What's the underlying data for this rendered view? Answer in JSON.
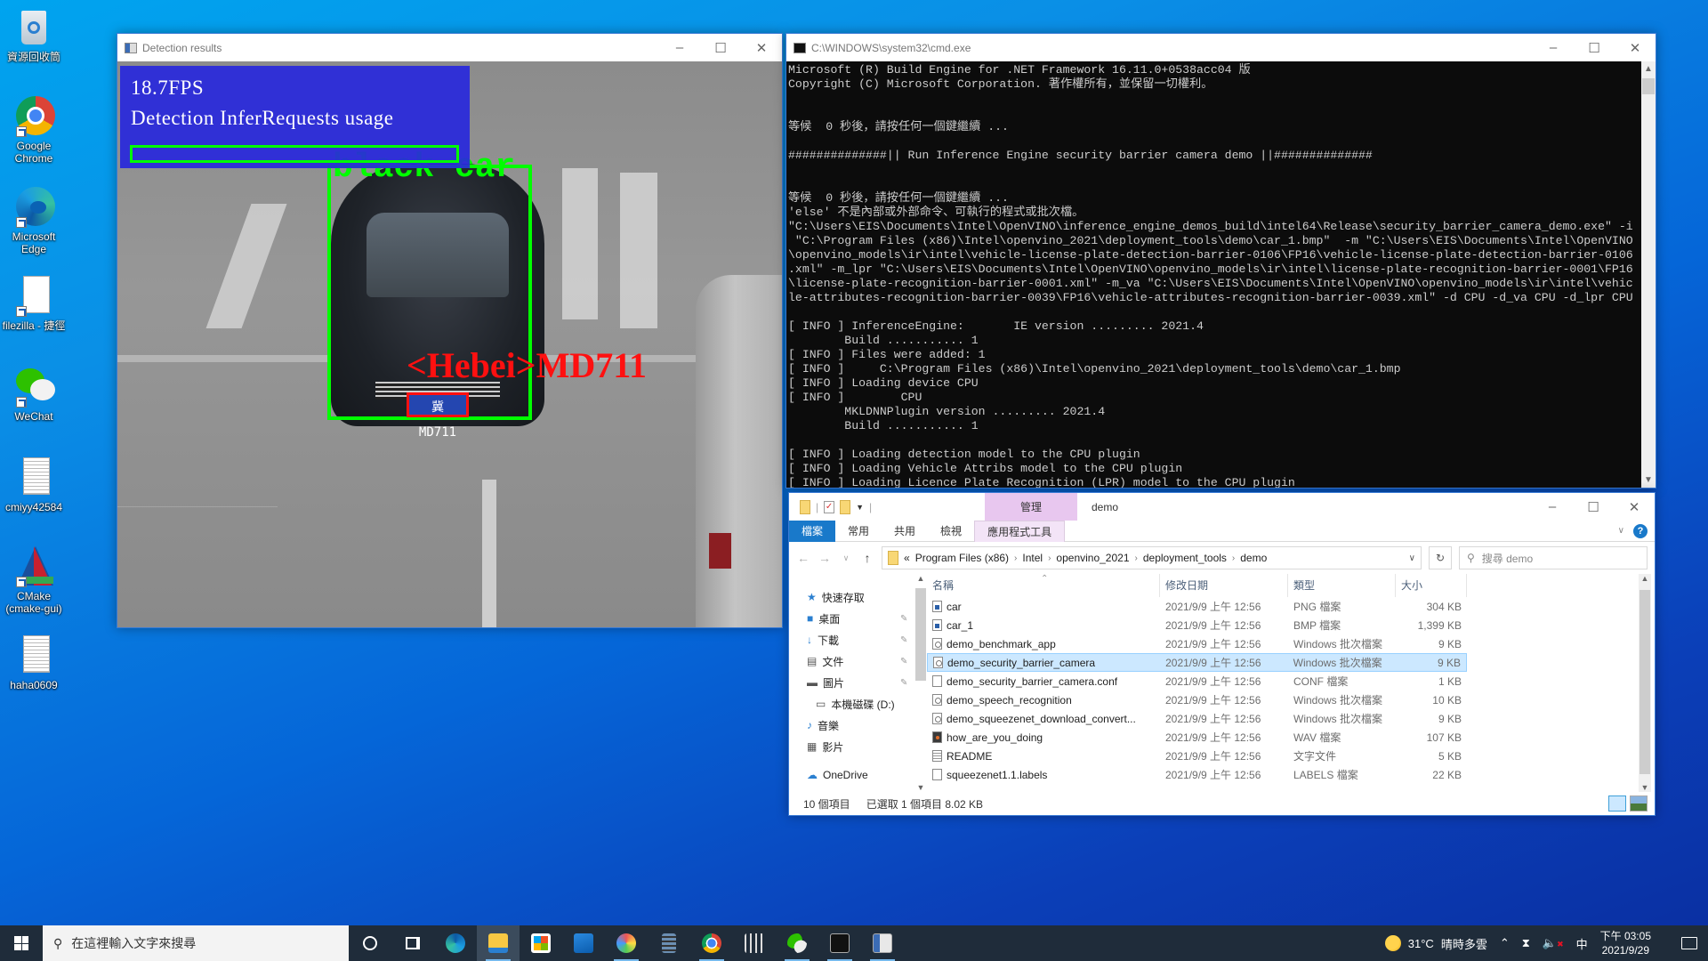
{
  "desktop": {
    "icons": [
      {
        "name": "recycle-bin",
        "label": "資源回收筒"
      },
      {
        "name": "google-chrome",
        "label": "Google Chrome"
      },
      {
        "name": "microsoft-edge",
        "label": "Microsoft Edge"
      },
      {
        "name": "filezilla-shortcut",
        "label": "filezilla - 捷徑"
      },
      {
        "name": "wechat",
        "label": "WeChat"
      },
      {
        "name": "cmiyy42584",
        "label": "cmiyy42584"
      },
      {
        "name": "cmake-gui",
        "label": "CMake (cmake-gui)"
      },
      {
        "name": "haha0609",
        "label": "haha0609"
      }
    ]
  },
  "detection_window": {
    "title": "Detection results",
    "fps": "18.7FPS",
    "usage_label": "Detection InferRequests usage",
    "usage_fraction": 0.0,
    "vehicle_label": "black car",
    "plate_label": "<Hebei>MD711",
    "plate_text": "冀 MD711",
    "colors": {
      "vehicle_box": "#00ff00",
      "plate_box": "#ff1010",
      "overlay": "#2828dc"
    }
  },
  "cmd_window": {
    "title": "C:\\WINDOWS\\system32\\cmd.exe",
    "lines": [
      "Microsoft (R) Build Engine for .NET Framework 16.11.0+0538acc04 版",
      "Copyright (C) Microsoft Corporation. 著作權所有，並保留一切權利。",
      "",
      "",
      "等候  0 秒後，請按任何一個鍵繼續 ...",
      "",
      "##############|| Run Inference Engine security barrier camera demo ||##############",
      "",
      "",
      "等候  0 秒後，請按任何一個鍵繼續 ...",
      "'else' 不是內部或外部命令、可執行的程式或批次檔。",
      "\"C:\\Users\\EIS\\Documents\\Intel\\OpenVINO\\inference_engine_demos_build\\intel64\\Release\\security_barrier_camera_demo.exe\" -i",
      " \"C:\\Program Files (x86)\\Intel\\openvino_2021\\deployment_tools\\demo\\car_1.bmp\"  -m \"C:\\Users\\EIS\\Documents\\Intel\\OpenVINO",
      "\\openvino_models\\ir\\intel\\vehicle-license-plate-detection-barrier-0106\\FP16\\vehicle-license-plate-detection-barrier-0106",
      ".xml\" -m_lpr \"C:\\Users\\EIS\\Documents\\Intel\\OpenVINO\\openvino_models\\ir\\intel\\license-plate-recognition-barrier-0001\\FP16",
      "\\license-plate-recognition-barrier-0001.xml\" -m_va \"C:\\Users\\EIS\\Documents\\Intel\\OpenVINO\\openvino_models\\ir\\intel\\vehic",
      "le-attributes-recognition-barrier-0039\\FP16\\vehicle-attributes-recognition-barrier-0039.xml\" -d CPU -d_va CPU -d_lpr CPU",
      "",
      "[ INFO ] InferenceEngine:       IE version ......... 2021.4",
      "        Build ........... 1",
      "[ INFO ] Files were added: 1",
      "[ INFO ]     C:\\Program Files (x86)\\Intel\\openvino_2021\\deployment_tools\\demo\\car_1.bmp",
      "[ INFO ] Loading device CPU",
      "[ INFO ]        CPU",
      "        MKLDNNPlugin version ......... 2021.4",
      "        Build ........... 1",
      "",
      "[ INFO ] Loading detection model to the CPU plugin",
      "[ INFO ] Loading Vehicle Attribs model to the CPU plugin",
      "[ INFO ] Loading Licence Plate Recognition (LPR) model to the CPU plugin"
    ]
  },
  "explorer": {
    "title": "demo",
    "context_tab": "管理",
    "ribbon_tabs": [
      "檔案",
      "常用",
      "共用",
      "檢視",
      "應用程式工具"
    ],
    "breadcrumb": [
      "Program Files (x86)",
      "Intel",
      "openvino_2021",
      "deployment_tools",
      "demo"
    ],
    "breadcrumb_overflow": "«",
    "search_placeholder": "搜尋 demo",
    "nav_pane": [
      {
        "icon": "star-icon",
        "label": "快速存取",
        "pinned": false
      },
      {
        "icon": "desktop-icon",
        "label": "桌面",
        "pinned": true
      },
      {
        "icon": "download-icon",
        "label": "下載",
        "pinned": true
      },
      {
        "icon": "documents-icon",
        "label": "文件",
        "pinned": true
      },
      {
        "icon": "pictures-icon",
        "label": "圖片",
        "pinned": true
      },
      {
        "icon": "drive-icon",
        "label": "本機磁碟 (D:)",
        "pinned": false
      },
      {
        "icon": "music-icon",
        "label": "音樂",
        "pinned": false
      },
      {
        "icon": "video-icon",
        "label": "影片",
        "pinned": false
      },
      {
        "icon": "onedrive-icon",
        "label": "OneDrive",
        "pinned": false
      }
    ],
    "columns": [
      "名稱",
      "修改日期",
      "類型",
      "大小"
    ],
    "files": [
      {
        "name": "car",
        "date": "2021/9/9 上午 12:56",
        "type": "PNG 檔案",
        "size": "304 KB",
        "kind": "img",
        "selected": false
      },
      {
        "name": "car_1",
        "date": "2021/9/9 上午 12:56",
        "type": "BMP 檔案",
        "size": "1,399 KB",
        "kind": "img",
        "selected": false
      },
      {
        "name": "demo_benchmark_app",
        "date": "2021/9/9 上午 12:56",
        "type": "Windows 批次檔案",
        "size": "9 KB",
        "kind": "bat",
        "selected": false
      },
      {
        "name": "demo_security_barrier_camera",
        "date": "2021/9/9 上午 12:56",
        "type": "Windows 批次檔案",
        "size": "9 KB",
        "kind": "bat",
        "selected": true
      },
      {
        "name": "demo_security_barrier_camera.conf",
        "date": "2021/9/9 上午 12:56",
        "type": "CONF 檔案",
        "size": "1 KB",
        "kind": "blank",
        "selected": false
      },
      {
        "name": "demo_speech_recognition",
        "date": "2021/9/9 上午 12:56",
        "type": "Windows 批次檔案",
        "size": "10 KB",
        "kind": "bat",
        "selected": false
      },
      {
        "name": "demo_squeezenet_download_convert...",
        "date": "2021/9/9 上午 12:56",
        "type": "Windows 批次檔案",
        "size": "9 KB",
        "kind": "bat",
        "selected": false
      },
      {
        "name": "how_are_you_doing",
        "date": "2021/9/9 上午 12:56",
        "type": "WAV 檔案",
        "size": "107 KB",
        "kind": "wav",
        "selected": false
      },
      {
        "name": "README",
        "date": "2021/9/9 上午 12:56",
        "type": "文字文件",
        "size": "5 KB",
        "kind": "txt",
        "selected": false
      },
      {
        "name": "squeezenet1.1.labels",
        "date": "2021/9/9 上午 12:56",
        "type": "LABELS 檔案",
        "size": "22 KB",
        "kind": "blank",
        "selected": false
      }
    ],
    "status": {
      "count": "10 個項目",
      "selected": "已選取 1 個項目  8.02 KB"
    }
  },
  "taskbar": {
    "search_placeholder": "在這裡輸入文字來搜尋",
    "apps": [
      "cortana",
      "task-view",
      "edge",
      "file-explorer",
      "store",
      "mail",
      "paint",
      "calculator",
      "chrome",
      "app-tool",
      "wechat",
      "cmd",
      "notepad-window"
    ],
    "weather": {
      "temp": "31°C",
      "desc": "晴時多雲"
    },
    "ime": "中",
    "time": "下午 03:05",
    "date": "2021/9/29"
  }
}
